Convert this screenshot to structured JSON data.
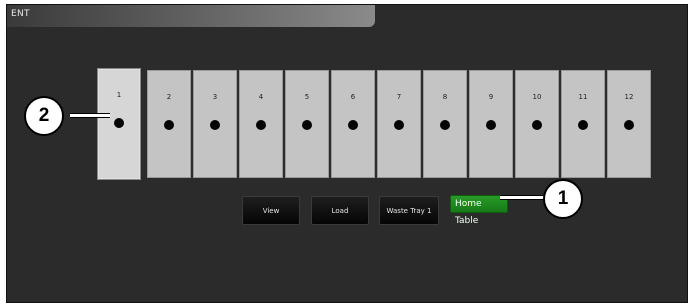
{
  "window": {
    "title_fragment": "ENT"
  },
  "rack": {
    "selected_slot": "1",
    "slots": [
      {
        "number": "1"
      },
      {
        "number": "2"
      },
      {
        "number": "3"
      },
      {
        "number": "4"
      },
      {
        "number": "5"
      },
      {
        "number": "6"
      },
      {
        "number": "7"
      },
      {
        "number": "8"
      },
      {
        "number": "9"
      },
      {
        "number": "10"
      },
      {
        "number": "11"
      },
      {
        "number": "12"
      }
    ]
  },
  "buttons": {
    "view": "View",
    "load": "Load",
    "waste_tray": "Waste Tray 1",
    "home_table": "Home Table"
  },
  "callouts": {
    "one": "1",
    "two": "2"
  },
  "colors": {
    "background": "#2b2b2b",
    "slot": "#c4c4c4",
    "home_button": "#1f8a1f",
    "dark_button": "#0a0a0a"
  },
  "icons": {
    "slot_marker": "black-dot"
  }
}
